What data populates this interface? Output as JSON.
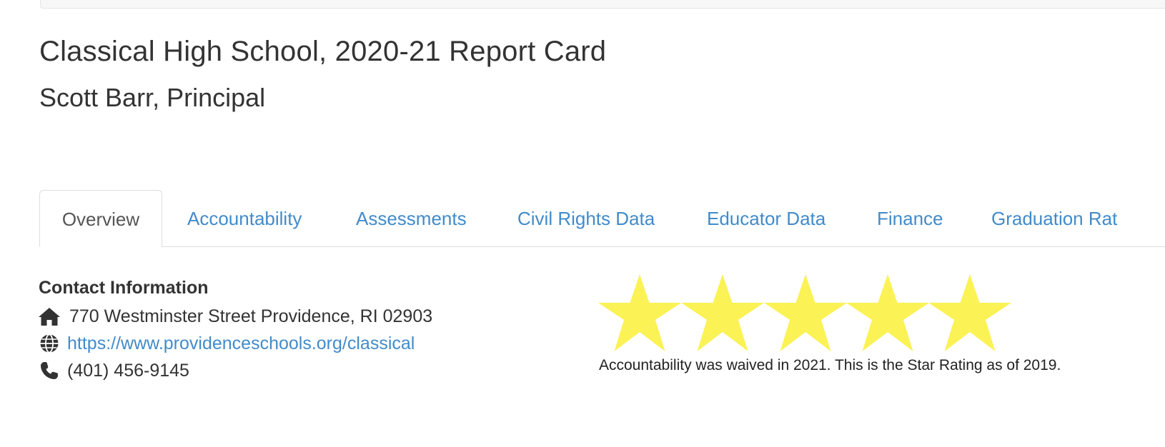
{
  "header": {
    "title": "Classical High School, 2020-21 Report Card",
    "principal": "Scott Barr, Principal"
  },
  "tabs": [
    {
      "label": "Overview",
      "active": true
    },
    {
      "label": "Accountability",
      "active": false
    },
    {
      "label": "Assessments",
      "active": false
    },
    {
      "label": "Civil Rights Data",
      "active": false
    },
    {
      "label": "Educator Data",
      "active": false
    },
    {
      "label": "Finance",
      "active": false
    },
    {
      "label": "Graduation Rat",
      "active": false
    }
  ],
  "contact": {
    "heading": "Contact Information",
    "address": "770 Westminster Street Providence, RI 02903",
    "website": "https://www.providenceschools.org/classical",
    "phone": "(401) 456-9145",
    "icons": [
      "home-icon",
      "globe-icon",
      "phone-icon"
    ]
  },
  "rating": {
    "stars": 5,
    "max_stars": 5,
    "star_color": "#fbf255",
    "note": "Accountability was waived in 2021. This is the Star Rating as of 2019."
  },
  "colors": {
    "link": "#428bca",
    "text": "#333333",
    "tab_border": "#dddddd"
  }
}
